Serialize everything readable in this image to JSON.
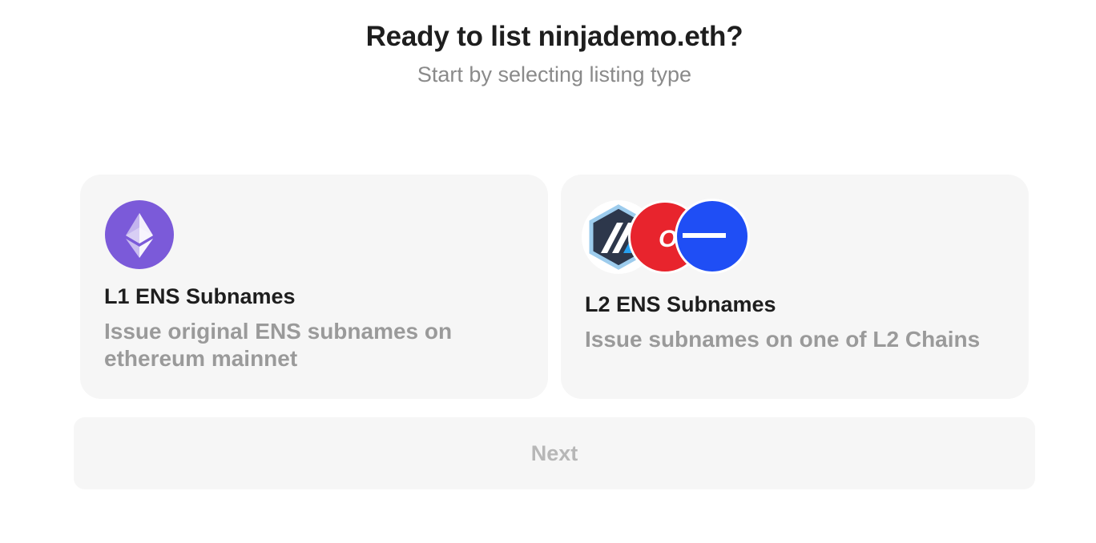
{
  "header": {
    "title": "Ready to list ninjademo.eth?",
    "subtitle": "Start by selecting listing type"
  },
  "options": [
    {
      "id": "l1",
      "icon": "ethereum-icon",
      "title": "L1 ENS Subnames",
      "description": "Issue original ENS subnames on ethereum mainnet"
    },
    {
      "id": "l2",
      "icons": [
        "arbitrum-icon",
        "optimism-icon",
        "base-icon"
      ],
      "icon_text": {
        "optimism": "OP"
      },
      "title": "L2 ENS Subnames",
      "description": "Issue subnames on one of L2 Chains"
    }
  ],
  "footer": {
    "next_label": "Next"
  },
  "colors": {
    "ethereum": "#7b5ad9",
    "optimism": "#e8242d",
    "base": "#1f4ef5",
    "card_bg": "#f6f6f6",
    "muted_text": "#9a9a9a"
  }
}
